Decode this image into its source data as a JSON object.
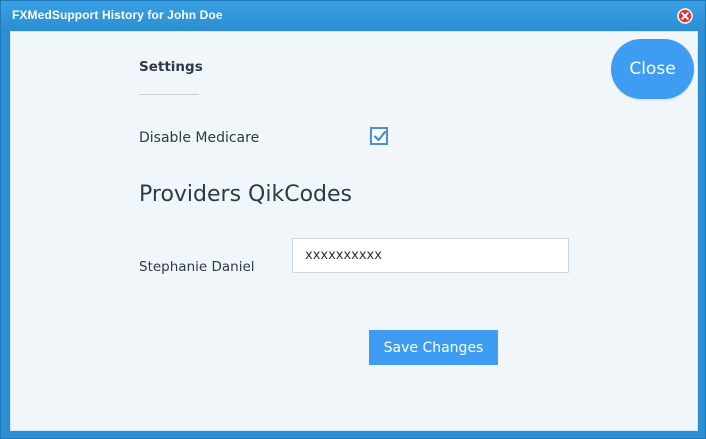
{
  "window": {
    "title": "FXMedSupport History for John Doe"
  },
  "content": {
    "close_label": "Close",
    "settings_heading": "Settings",
    "disable_medicare": {
      "label": "Disable Medicare",
      "checked": true
    },
    "providers_heading": "Providers QikCodes",
    "providers": [
      {
        "name": "Stephanie Daniel",
        "qikcode": "xxxxxxxxxx"
      }
    ],
    "save_label": "Save Changes"
  },
  "colors": {
    "titlebar": "#2b8ed1",
    "accent": "#3f9cf3",
    "panel_background": "#f1f6fb",
    "text": "#2d3b47"
  }
}
